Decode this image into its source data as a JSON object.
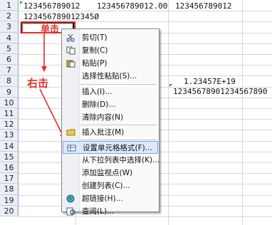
{
  "rows": [
    "1",
    "2",
    "3",
    "4",
    "5",
    "6",
    "7",
    "8",
    "9",
    "10",
    "11",
    "12",
    "13",
    "14",
    "15",
    "16",
    "17",
    "18",
    "19",
    "20"
  ],
  "cells": {
    "a1": "123456789012",
    "b1": "123456789012.00",
    "c1": "123456789012",
    "a2": "123456789012345Ø",
    "c8": "1.23457E+19",
    "c9": "12345678901234567890"
  },
  "annotations": {
    "click": "单击",
    "right_click": "右击"
  },
  "menu": {
    "items": [
      {
        "label": "剪切(T)",
        "icon": "scissors-icon"
      },
      {
        "label": "复制(C)",
        "icon": "copy-icon"
      },
      {
        "label": "粘贴(P)",
        "icon": "paste-icon"
      },
      {
        "label": "选择性粘贴(S)...",
        "icon": ""
      },
      {
        "label": "插入(I)...",
        "icon": ""
      },
      {
        "label": "删除(D)...",
        "icon": ""
      },
      {
        "label": "清除内容(N)",
        "icon": ""
      },
      {
        "label": "插入批注(M)",
        "icon": "comment-icon"
      },
      {
        "label": "设置单元格格式(F)...",
        "icon": "format-cells-icon"
      },
      {
        "label": "从下拉列表中选择(K)...",
        "icon": ""
      },
      {
        "label": "添加监视点(W)",
        "icon": ""
      },
      {
        "label": "创建列表(C)...",
        "icon": ""
      },
      {
        "label": "超链接(H)...",
        "icon": "hyperlink-icon"
      },
      {
        "label": "查阅(L)...",
        "icon": "lookup-icon"
      }
    ]
  },
  "colors": {
    "accent_red": "#e0302a",
    "highlight": "#dce9fb"
  }
}
